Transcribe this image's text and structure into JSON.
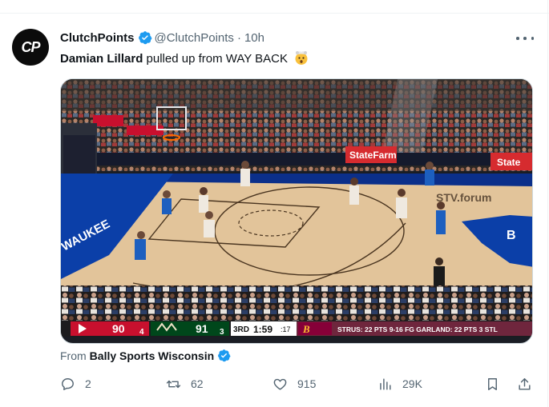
{
  "tweet": {
    "author_name": "ClutchPoints",
    "handle": "@ClutchPoints",
    "separator": "·",
    "time": "10h",
    "avatar_text": "CP",
    "text_bold": "Damian Lillard",
    "text_rest": " pulled up from WAY BACK",
    "emoji": "exploding-head-emoji"
  },
  "media": {
    "scoreboard": {
      "team1_score": "90",
      "team1_fouls": "4",
      "team2_score": "91",
      "team2_fouls": "3",
      "quarter": "3RD",
      "clock": "1:59",
      "shot_clock": ":17",
      "stat_line": "STRUS: 22 PTS  9-16 FG  GARLAND: 22 PTS  3 STL"
    },
    "signs": {
      "statefarm_left": "StateFarm",
      "statefarm_right": "State",
      "court_text": "STV.forum",
      "baseline_text": "WAUKEE",
      "floor_logo": "B"
    }
  },
  "source": {
    "prefix": "From",
    "name": "Bally Sports Wisconsin"
  },
  "actions": {
    "replies": "2",
    "reposts": "62",
    "likes": "915",
    "views": "29K"
  },
  "colors": {
    "verified": "#1d9bf0",
    "muted": "#536471",
    "text": "#0f1419"
  }
}
